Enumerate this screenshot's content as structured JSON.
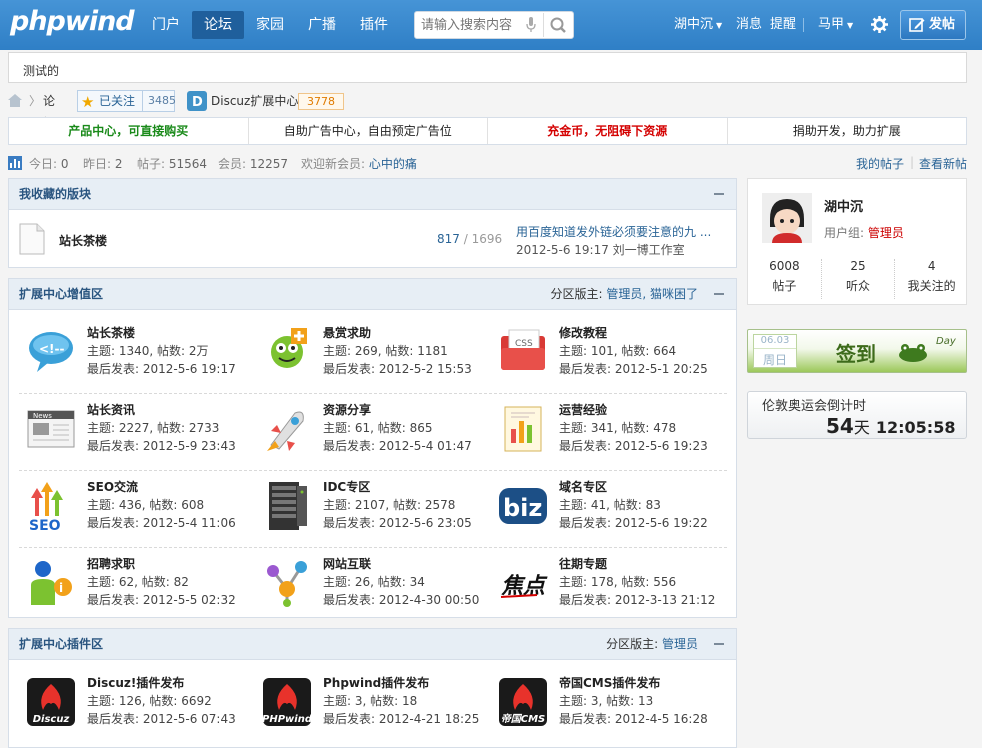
{
  "header": {
    "logo": "phpwind",
    "nav": [
      "门户",
      "论坛",
      "家园",
      "广播",
      "插件"
    ],
    "search_placeholder": "请输入搜索内容",
    "user": "湖中沉",
    "messages": "消息",
    "remind": "提醒",
    "user2": "马甲",
    "post_button": "发帖"
  },
  "notice": "测试的",
  "breadcrumb": {
    "forum": "论坛",
    "follow": "已关注",
    "follow_count": "3485",
    "ext": "Discuz扩展中心",
    "ext_count": "3778"
  },
  "ads": [
    "产品中心，可直接购买",
    "自助广告中心，自由预定广告位",
    "充金币，无阻碍下资源",
    "捐助开发，助力扩展"
  ],
  "stats": {
    "today_label": "今日: ",
    "today": "0",
    "yesterday_label": "昨日: ",
    "yesterday": "2",
    "posts_label": "帖子: ",
    "posts": "51564",
    "members_label": "会员: ",
    "members": "12257",
    "welcome": "欢迎新会员: ",
    "newmember": "心中的痛",
    "mine": "我的帖子",
    "new": "查看新帖"
  },
  "fav": {
    "title": "我收藏的版块",
    "forum": "站长茶楼",
    "a": "817",
    "sep": " / ",
    "b": "1696",
    "last_title": "用百度知道发外链必须要注意的九 ...",
    "last_info": "2012-5-6 19:17 刘一博工作室"
  },
  "zone1": {
    "title": "扩展中心增值区",
    "mods_label": "分区版主: ",
    "mods": "管理员, 猫咪困了",
    "forums": [
      {
        "name": "站长茶楼",
        "stat": "主题: 1340, 帖数: 2万",
        "last": "最后发表: 2012-5-6 19:17",
        "icon": "chat-bubble-icon"
      },
      {
        "name": "悬赏求助",
        "stat": "主题: 269, 帖数: 1181",
        "last": "最后发表: 2012-5-2 15:53",
        "icon": "helper-robot-icon"
      },
      {
        "name": "修改教程",
        "stat": "主题: 101, 帖数: 664",
        "last": "最后发表: 2012-5-1 20:25",
        "icon": "css-folder-icon"
      },
      {
        "name": "站长资讯",
        "stat": "主题: 2227, 帖数: 2733",
        "last": "最后发表: 2012-5-9 23:43",
        "icon": "newspaper-icon"
      },
      {
        "name": "资源分享",
        "stat": "主题: 61, 帖数: 865",
        "last": "最后发表: 2012-5-4 01:47",
        "icon": "rocket-icon"
      },
      {
        "name": "运营经验",
        "stat": "主题: 341, 帖数: 478",
        "last": "最后发表: 2012-5-6 19:23",
        "icon": "report-chart-icon"
      },
      {
        "name": "SEO交流",
        "stat": "主题: 436, 帖数: 608",
        "last": "最后发表: 2012-5-4 11:06",
        "icon": "seo-arrows-icon"
      },
      {
        "name": "IDC专区",
        "stat": "主题: 2107, 帖数: 2578",
        "last": "最后发表: 2012-5-6 23:05",
        "icon": "server-rack-icon"
      },
      {
        "name": "域名专区",
        "stat": "主题: 41, 帖数: 83",
        "last": "最后发表: 2012-5-6 19:22",
        "icon": "biz-domain-icon"
      },
      {
        "name": "招聘求职",
        "stat": "主题: 62, 帖数: 82",
        "last": "最后发表: 2012-5-5 02:32",
        "icon": "person-icon"
      },
      {
        "name": "网站互联",
        "stat": "主题: 26, 帖数: 34",
        "last": "最后发表: 2012-4-30 00:50",
        "icon": "network-nodes-icon"
      },
      {
        "name": "往期专题",
        "stat": "主题: 178, 帖数: 556",
        "last": "最后发表: 2012-3-13 21:12",
        "icon": "focus-brush-icon"
      }
    ]
  },
  "zone2": {
    "title": "扩展中心插件区",
    "mods_label": "分区版主: ",
    "mods": "管理员",
    "forums": [
      {
        "name": "Discuz!插件发布",
        "stat": "主题: 126, 帖数: 6692",
        "last": "最后发表: 2012-5-6 07:43",
        "icon": "discuz-logo-icon",
        "tag": "Discuz"
      },
      {
        "name": "Phpwind插件发布",
        "stat": "主题: 3, 帖数: 18",
        "last": "最后发表: 2012-4-21 18:25",
        "icon": "phpwind-logo-icon",
        "tag": "PHPwind"
      },
      {
        "name": "帝国CMS插件发布",
        "stat": "主题: 3, 帖数: 13",
        "last": "最后发表: 2012-4-5 16:28",
        "icon": "empirecms-logo-icon",
        "tag": "帝国CMS"
      }
    ]
  },
  "profile": {
    "name": "湖中沉",
    "group_label": "用户组: ",
    "group": "管理员",
    "stats": [
      {
        "n": "6008",
        "l": "帖子"
      },
      {
        "n": "25",
        "l": "听众"
      },
      {
        "n": "4",
        "l": "我关注的"
      }
    ]
  },
  "signin": {
    "date": "06.03",
    "weekday": "周日",
    "label": "签到",
    "day": "Day"
  },
  "countdown": {
    "title": "伦敦奥运会倒计时",
    "days": "54",
    "days_unit": "天",
    "time": "12:05:58"
  },
  "colors": {
    "brand": "#3a8bd0",
    "green": "#1a8a1a",
    "red": "#d40000"
  }
}
